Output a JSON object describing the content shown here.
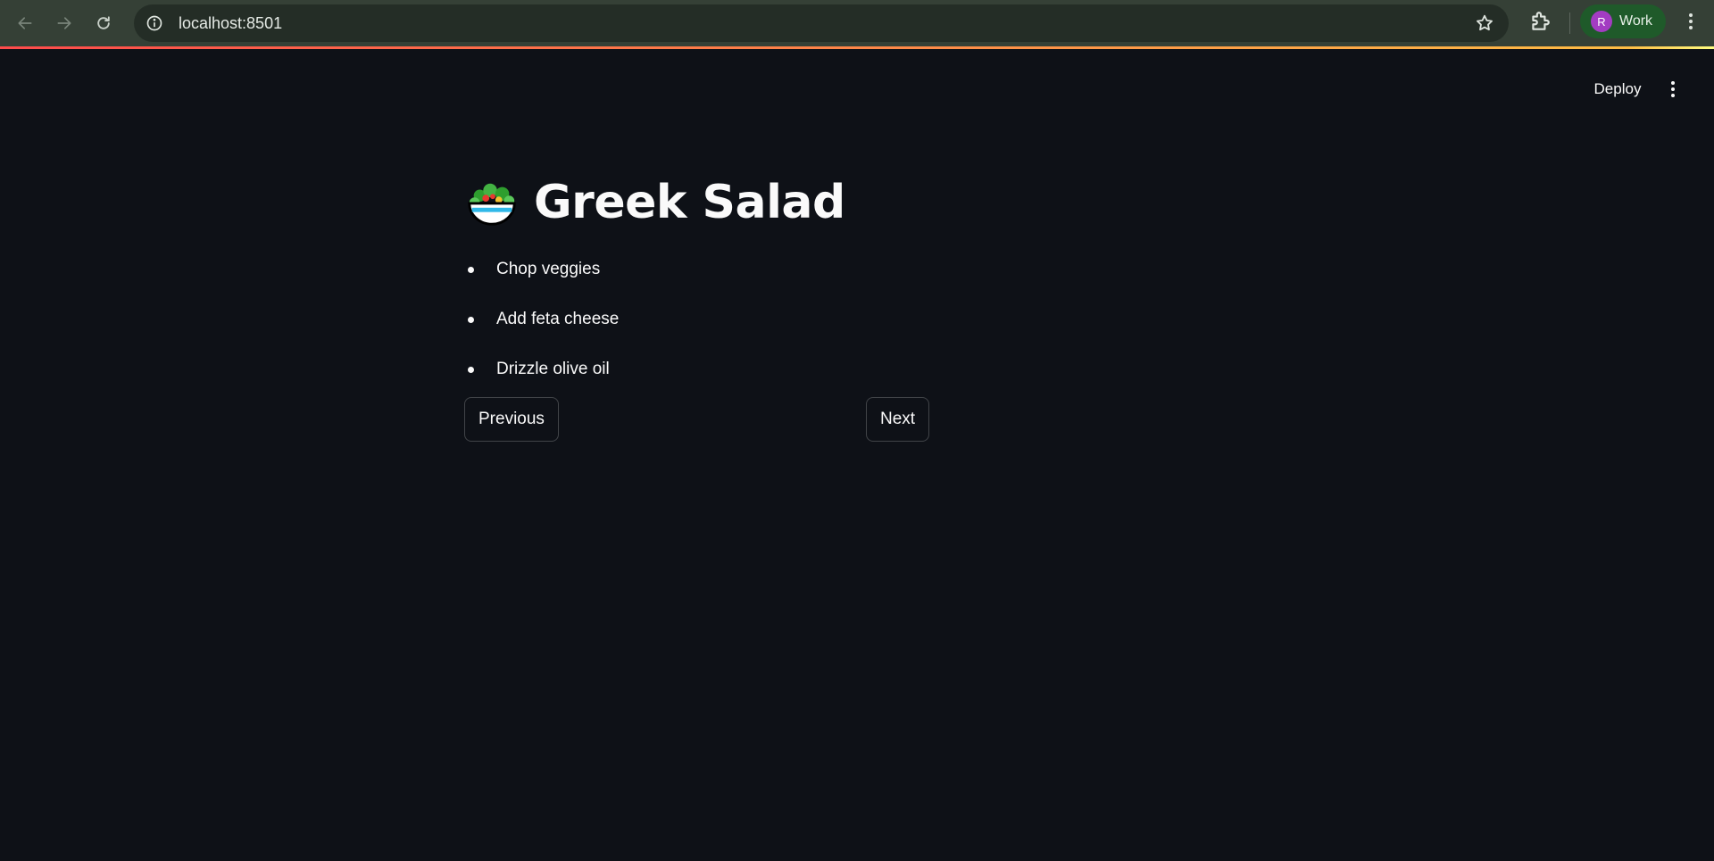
{
  "browser": {
    "url": "localhost:8501",
    "profile_initial": "R",
    "profile_name": "Work"
  },
  "toolbar": {
    "deploy_label": "Deploy"
  },
  "recipe": {
    "title": "Greek Salad",
    "steps": [
      "Chop veggies",
      "Add feta cheese",
      "Drizzle olive oil"
    ]
  },
  "navigation": {
    "previous_label": "Previous",
    "next_label": "Next"
  },
  "colors": {
    "background": "#0e1117",
    "text": "#fafafa",
    "browser_frame": "#354036",
    "profile_chip": "#1f5a2a",
    "avatar": "#a33cc2",
    "accent_gradient_start": "#ff4b4b",
    "accent_gradient_end": "#fffd80"
  },
  "icons": {
    "title_icon": "green-salad-icon"
  }
}
